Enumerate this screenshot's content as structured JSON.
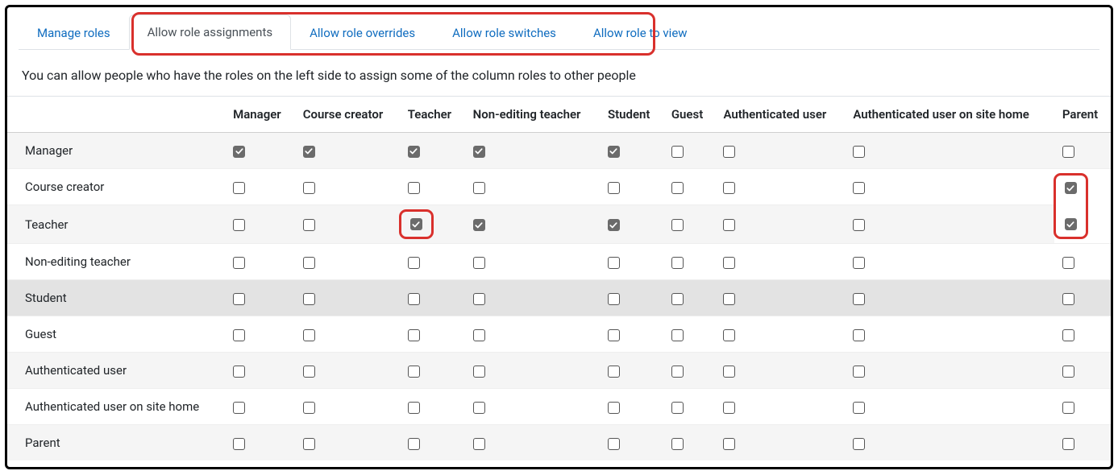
{
  "tabs": [
    {
      "id": "manage-roles",
      "label": "Manage roles",
      "active": false
    },
    {
      "id": "allow-assignments",
      "label": "Allow role assignments",
      "active": true
    },
    {
      "id": "allow-overrides",
      "label": "Allow role overrides",
      "active": false
    },
    {
      "id": "allow-switches",
      "label": "Allow role switches",
      "active": false
    },
    {
      "id": "allow-view",
      "label": "Allow role to view",
      "active": false
    }
  ],
  "description": "You can allow people who have the roles on the left side to assign some of the column roles to other people",
  "columns": [
    "Manager",
    "Course creator",
    "Teacher",
    "Non-editing teacher",
    "Student",
    "Guest",
    "Authenticated user",
    "Authenticated user on site home",
    "Parent"
  ],
  "rows": [
    {
      "label": "Manager",
      "cls": "",
      "cells": [
        {
          "c": true
        },
        {
          "c": true
        },
        {
          "c": true
        },
        {
          "c": true
        },
        {
          "c": true
        },
        {
          "c": false
        },
        {
          "c": false
        },
        {
          "c": false
        },
        {
          "c": false
        }
      ]
    },
    {
      "label": "Course creator",
      "cls": "",
      "cells": [
        {
          "c": false
        },
        {
          "c": false
        },
        {
          "c": false
        },
        {
          "c": false
        },
        {
          "c": false
        },
        {
          "c": false
        },
        {
          "c": false
        },
        {
          "c": false
        },
        {
          "c": true,
          "hl": "group-top"
        }
      ]
    },
    {
      "label": "Teacher",
      "cls": "",
      "cells": [
        {
          "c": false
        },
        {
          "c": false
        },
        {
          "c": true,
          "hl": "single"
        },
        {
          "c": true
        },
        {
          "c": true
        },
        {
          "c": false
        },
        {
          "c": false
        },
        {
          "c": false
        },
        {
          "c": true,
          "hl": "group-bottom"
        }
      ]
    },
    {
      "label": "Non-editing teacher",
      "cls": "",
      "cells": [
        {
          "c": false
        },
        {
          "c": false
        },
        {
          "c": false
        },
        {
          "c": false
        },
        {
          "c": false
        },
        {
          "c": false
        },
        {
          "c": false
        },
        {
          "c": false
        },
        {
          "c": false
        }
      ]
    },
    {
      "label": "Student",
      "cls": "student-hl",
      "cells": [
        {
          "c": false
        },
        {
          "c": false
        },
        {
          "c": false
        },
        {
          "c": false
        },
        {
          "c": false
        },
        {
          "c": false
        },
        {
          "c": false
        },
        {
          "c": false
        },
        {
          "c": false
        }
      ]
    },
    {
      "label": "Guest",
      "cls": "",
      "cells": [
        {
          "c": false
        },
        {
          "c": false
        },
        {
          "c": false
        },
        {
          "c": false
        },
        {
          "c": false
        },
        {
          "c": false
        },
        {
          "c": false
        },
        {
          "c": false
        },
        {
          "c": false
        }
      ]
    },
    {
      "label": "Authenticated user",
      "cls": "",
      "cells": [
        {
          "c": false
        },
        {
          "c": false
        },
        {
          "c": false
        },
        {
          "c": false
        },
        {
          "c": false
        },
        {
          "c": false
        },
        {
          "c": false
        },
        {
          "c": false
        },
        {
          "c": false
        }
      ]
    },
    {
      "label": "Authenticated user on site home",
      "cls": "",
      "cells": [
        {
          "c": false
        },
        {
          "c": false
        },
        {
          "c": false
        },
        {
          "c": false
        },
        {
          "c": false
        },
        {
          "c": false
        },
        {
          "c": false
        },
        {
          "c": false
        },
        {
          "c": false
        }
      ]
    },
    {
      "label": "Parent",
      "cls": "",
      "cells": [
        {
          "c": false
        },
        {
          "c": false
        },
        {
          "c": false
        },
        {
          "c": false
        },
        {
          "c": false
        },
        {
          "c": false
        },
        {
          "c": false
        },
        {
          "c": false
        },
        {
          "c": false
        }
      ]
    }
  ]
}
